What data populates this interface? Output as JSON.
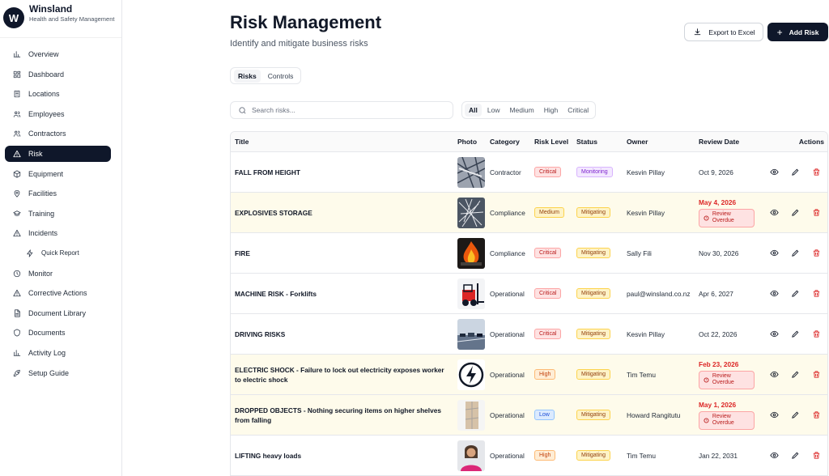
{
  "brand": {
    "name": "Winsland",
    "subtitle": "Health and Safety Management",
    "logo_letter": "W"
  },
  "sidebar": {
    "items": [
      {
        "label": "Overview",
        "icon": "bar-chart-icon",
        "active": false
      },
      {
        "label": "Dashboard",
        "icon": "dashboard-icon",
        "active": false
      },
      {
        "label": "Locations",
        "icon": "building-icon",
        "active": false
      },
      {
        "label": "Employees",
        "icon": "users-icon",
        "active": false
      },
      {
        "label": "Contractors",
        "icon": "users-icon",
        "active": false
      },
      {
        "label": "Risk",
        "icon": "warning-icon",
        "active": true
      },
      {
        "label": "Equipment",
        "icon": "box-icon",
        "active": false
      },
      {
        "label": "Facilities",
        "icon": "map-pin-icon",
        "active": false
      },
      {
        "label": "Training",
        "icon": "graduation-cap-icon",
        "active": false
      },
      {
        "label": "Incidents",
        "icon": "warning-icon",
        "active": false
      },
      {
        "label": "Quick Report",
        "icon": "zap-icon",
        "active": false,
        "sub": true
      },
      {
        "label": "Monitor",
        "icon": "clock-icon",
        "active": false
      },
      {
        "label": "Corrective Actions",
        "icon": "warning-icon",
        "active": false
      },
      {
        "label": "Document Library",
        "icon": "file-icon",
        "active": false
      },
      {
        "label": "Documents",
        "icon": "shield-icon",
        "active": false
      },
      {
        "label": "Activity Log",
        "icon": "bar-chart-icon",
        "active": false
      },
      {
        "label": "Setup Guide",
        "icon": "rocket-icon",
        "active": false
      }
    ]
  },
  "header": {
    "title": "Risk Management",
    "subtitle": "Identify and mitigate business risks",
    "export_label": "Export to Excel",
    "add_label": "Add Risk"
  },
  "tabs": [
    {
      "label": "Risks",
      "active": true
    },
    {
      "label": "Controls",
      "active": false
    }
  ],
  "search": {
    "placeholder": "Search risks..."
  },
  "filters": [
    {
      "label": "All",
      "active": true
    },
    {
      "label": "Low",
      "active": false
    },
    {
      "label": "Medium",
      "active": false
    },
    {
      "label": "High",
      "active": false
    },
    {
      "label": "Critical",
      "active": false
    }
  ],
  "table": {
    "columns": [
      "Title",
      "Photo",
      "Category",
      "Risk Level",
      "Status",
      "Owner",
      "Review Date",
      "Actions"
    ],
    "overdue_label": "Review Overdue",
    "rows": [
      {
        "title": "FALL FROM HEIGHT",
        "photo": "scaffolding-photo",
        "category": "Contractor",
        "level": "Critical",
        "status": "Monitoring",
        "owner": "Kesvin Pillay",
        "date": "Oct 9, 2026",
        "overdue": false
      },
      {
        "title": "EXPLOSIVES STORAGE",
        "photo": "debris-photo",
        "category": "Compliance",
        "level": "Medium",
        "status": "Mitigating",
        "owner": "Kesvin Pillay",
        "date": "May 4, 2026",
        "overdue": true
      },
      {
        "title": "FIRE",
        "photo": "fire-photo",
        "category": "Compliance",
        "level": "Critical",
        "status": "Mitigating",
        "owner": "Sally Fili",
        "date": "Nov 30, 2026",
        "overdue": false
      },
      {
        "title": "MACHINE RISK - Forklifts",
        "photo": "forklift-photo",
        "category": "Operational",
        "level": "Critical",
        "status": "Mitigating",
        "owner": "paul@winsland.co.nz",
        "date": "Apr 6, 2027",
        "overdue": false
      },
      {
        "title": "DRIVING RISKS",
        "photo": "traffic-photo",
        "category": "Operational",
        "level": "Critical",
        "status": "Mitigating",
        "owner": "Kesvin Pillay",
        "date": "Oct 22, 2026",
        "overdue": false
      },
      {
        "title": "ELECTRIC SHOCK - Failure to lock out electricity exposes worker to electric shock",
        "photo": "electric-icon-photo",
        "category": "Operational",
        "level": "High",
        "status": "Mitigating",
        "owner": "Tim Temu",
        "date": "Feb 23, 2026",
        "overdue": true
      },
      {
        "title": "DROPPED OBJECTS - Nothing securing items on higher shelves from falling",
        "photo": "shelf-photo",
        "category": "Operational",
        "level": "Low",
        "status": "Mitigating",
        "owner": "Howard Rangitutu",
        "date": "May 1, 2026",
        "overdue": true
      },
      {
        "title": "LIFTING heavy loads",
        "photo": "person-photo",
        "category": "Operational",
        "level": "High",
        "status": "Mitigating",
        "owner": "Tim Temu",
        "date": "Jan 22, 2031",
        "overdue": false
      }
    ]
  }
}
